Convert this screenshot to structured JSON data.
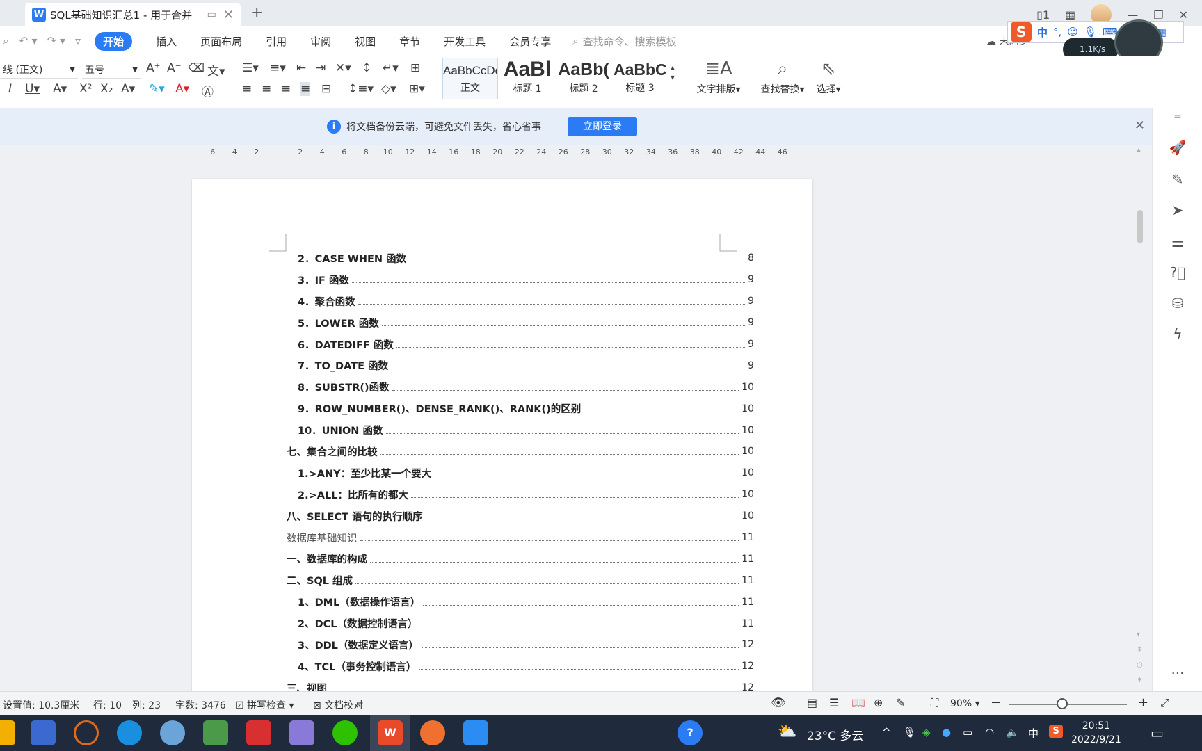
{
  "titlebar": {
    "doc_title": "SQL基础知识汇总1 - 用于合并"
  },
  "menu": {
    "items": [
      "开始",
      "插入",
      "页面布局",
      "引用",
      "审阅",
      "视图",
      "章节",
      "开发工具",
      "会员专享"
    ],
    "search_placeholder": "查找命令、搜索模板",
    "sync": "未同步"
  },
  "ime": {
    "lang": "中"
  },
  "network": {
    "speed": "1.1K/s"
  },
  "ribbon": {
    "font_name": "线 (正文)",
    "font_size": "五号",
    "styles": [
      {
        "preview": "AaBbCcDc",
        "label": "正文"
      },
      {
        "preview": "AaBl",
        "label": "标题 1"
      },
      {
        "preview": "AaBb(",
        "label": "标题 2"
      },
      {
        "preview": "AaBbC",
        "label": "标题 3"
      }
    ],
    "text_layout": "文字排版",
    "find_replace": "查找替换",
    "select": "选择"
  },
  "notice": {
    "message": "将文档备份云端，可避免文件丢失，省心省事",
    "login": "立即登录"
  },
  "ruler": [
    "6",
    "4",
    "2",
    "",
    "2",
    "4",
    "6",
    "8",
    "10",
    "12",
    "14",
    "16",
    "18",
    "20",
    "22",
    "24",
    "26",
    "28",
    "30",
    "32",
    "34",
    "36",
    "38",
    "40",
    "42",
    "44",
    "46"
  ],
  "toc": [
    {
      "text": "2．CASE WHEN  函数",
      "page": "8",
      "indent": 1
    },
    {
      "text": "3．IF 函数",
      "page": "9",
      "indent": 1
    },
    {
      "text": "4．聚合函数",
      "page": "9",
      "indent": 1
    },
    {
      "text": "5．LOWER 函数",
      "page": "9",
      "indent": 1
    },
    {
      "text": "6．DATEDIFF 函数",
      "page": "9",
      "indent": 1
    },
    {
      "text": "7．TO_DATE 函数",
      "page": "9",
      "indent": 1
    },
    {
      "text": "8．SUBSTR()函数",
      "page": "10",
      "indent": 1
    },
    {
      "text": "9．ROW_NUMBER()、DENSE_RANK()、RANK()的区别",
      "page": "10",
      "indent": 1
    },
    {
      "text": "10．UNION 函数",
      "page": "10",
      "indent": 1
    },
    {
      "text": "七、集合之间的比较",
      "page": "10",
      "indent": 0
    },
    {
      "text": "1.>ANY：至少比某一个要大",
      "page": "10",
      "indent": 1
    },
    {
      "text": "2.>ALL：比所有的都大",
      "page": "10",
      "indent": 1
    },
    {
      "text": "八、SELECT 语句的执行顺序",
      "page": "10",
      "indent": 0
    },
    {
      "text": "数据库基础知识",
      "page": "11",
      "indent": 0,
      "plain": true
    },
    {
      "text": "一、数据库的构成",
      "page": "11",
      "indent": 0
    },
    {
      "text": "二、SQL 组成",
      "page": "11",
      "indent": 0
    },
    {
      "text": "1、DML（数据操作语言）",
      "page": "11",
      "indent": 1
    },
    {
      "text": "2、DCL（数据控制语言）",
      "page": "11",
      "indent": 1
    },
    {
      "text": "3、DDL（数据定义语言）",
      "page": "12",
      "indent": 1
    },
    {
      "text": "4、TCL（事务控制语言）",
      "page": "12",
      "indent": 1
    },
    {
      "text": "三、视图",
      "page": "12",
      "indent": 0
    }
  ],
  "status": {
    "setting": "设置值: 10.3厘米",
    "row": "行: 10",
    "col": "列: 23",
    "words": "字数: 3476",
    "spell": "拼写检查",
    "proof": "文档校对",
    "zoom": "90%"
  },
  "taskbar": {
    "weather": "23°C  多云",
    "ime": "中",
    "time": "20:51",
    "date": "2022/9/21"
  }
}
